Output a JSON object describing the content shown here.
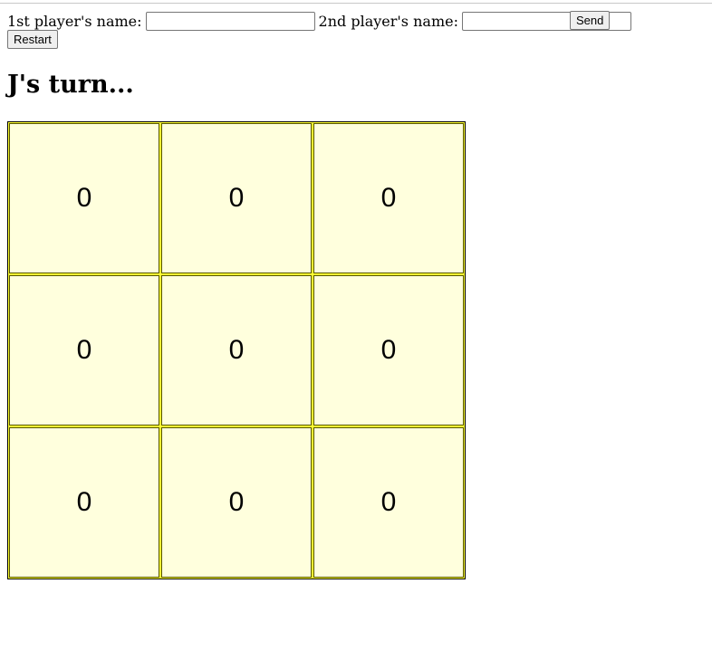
{
  "form": {
    "player1_label": "1st player's name:",
    "player1_value": "",
    "player2_label": "2nd player's name:",
    "player2_value": "",
    "send_label": "Send",
    "restart_label": "Restart"
  },
  "status": {
    "turn_text": "J's turn..."
  },
  "board": {
    "cells": [
      "0",
      "0",
      "0",
      "0",
      "0",
      "0",
      "0",
      "0",
      "0"
    ]
  }
}
